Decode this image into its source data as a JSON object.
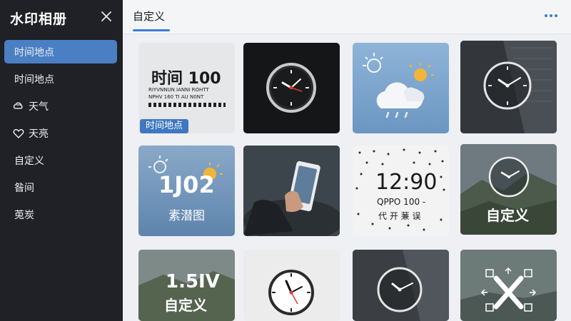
{
  "sidebar": {
    "title": "水印相册",
    "close_icon": "close-icon",
    "items": [
      {
        "label": "时间地点",
        "active": true,
        "icon": ""
      },
      {
        "label": "时间地点",
        "active": false,
        "icon": ""
      },
      {
        "label": "天气",
        "active": false,
        "icon": "cloud-sun-icon"
      },
      {
        "label": "天亮",
        "active": false,
        "icon": "heart-icon"
      },
      {
        "label": "自定义",
        "active": false,
        "icon": ""
      },
      {
        "label": "昝间",
        "active": false,
        "icon": ""
      },
      {
        "label": "莵炭",
        "active": false,
        "icon": ""
      }
    ]
  },
  "header": {
    "tab_label": "自定义",
    "more_icon": "more-icon"
  },
  "tiles": [
    {
      "big": "时间 100",
      "small": "RIYVNNUN IANNI ROHTT",
      "small2": "NPHV  160 TI  AU  N0NT",
      "badge": "时间地点"
    },
    {
      "kind": "clock-dark"
    },
    {
      "kind": "weather"
    },
    {
      "kind": "clock-building"
    },
    {
      "big": "1J02",
      "sub": "素潜图"
    },
    {
      "kind": "phone"
    },
    {
      "big": "12:90",
      "line2": "QPPO 100 -",
      "line3": "代 开 蒹 误"
    },
    {
      "sub": "自定义"
    },
    {
      "big": "1.5ⅠⅤ",
      "sub": "自定义"
    },
    {
      "kind": "clock-white"
    },
    {
      "kind": "clock-building2"
    },
    {
      "kind": "cross"
    }
  ],
  "colors": {
    "accent": "#3a7bd5",
    "sidebar_bg": "#1f2126",
    "active_item": "#4a7fc4"
  }
}
